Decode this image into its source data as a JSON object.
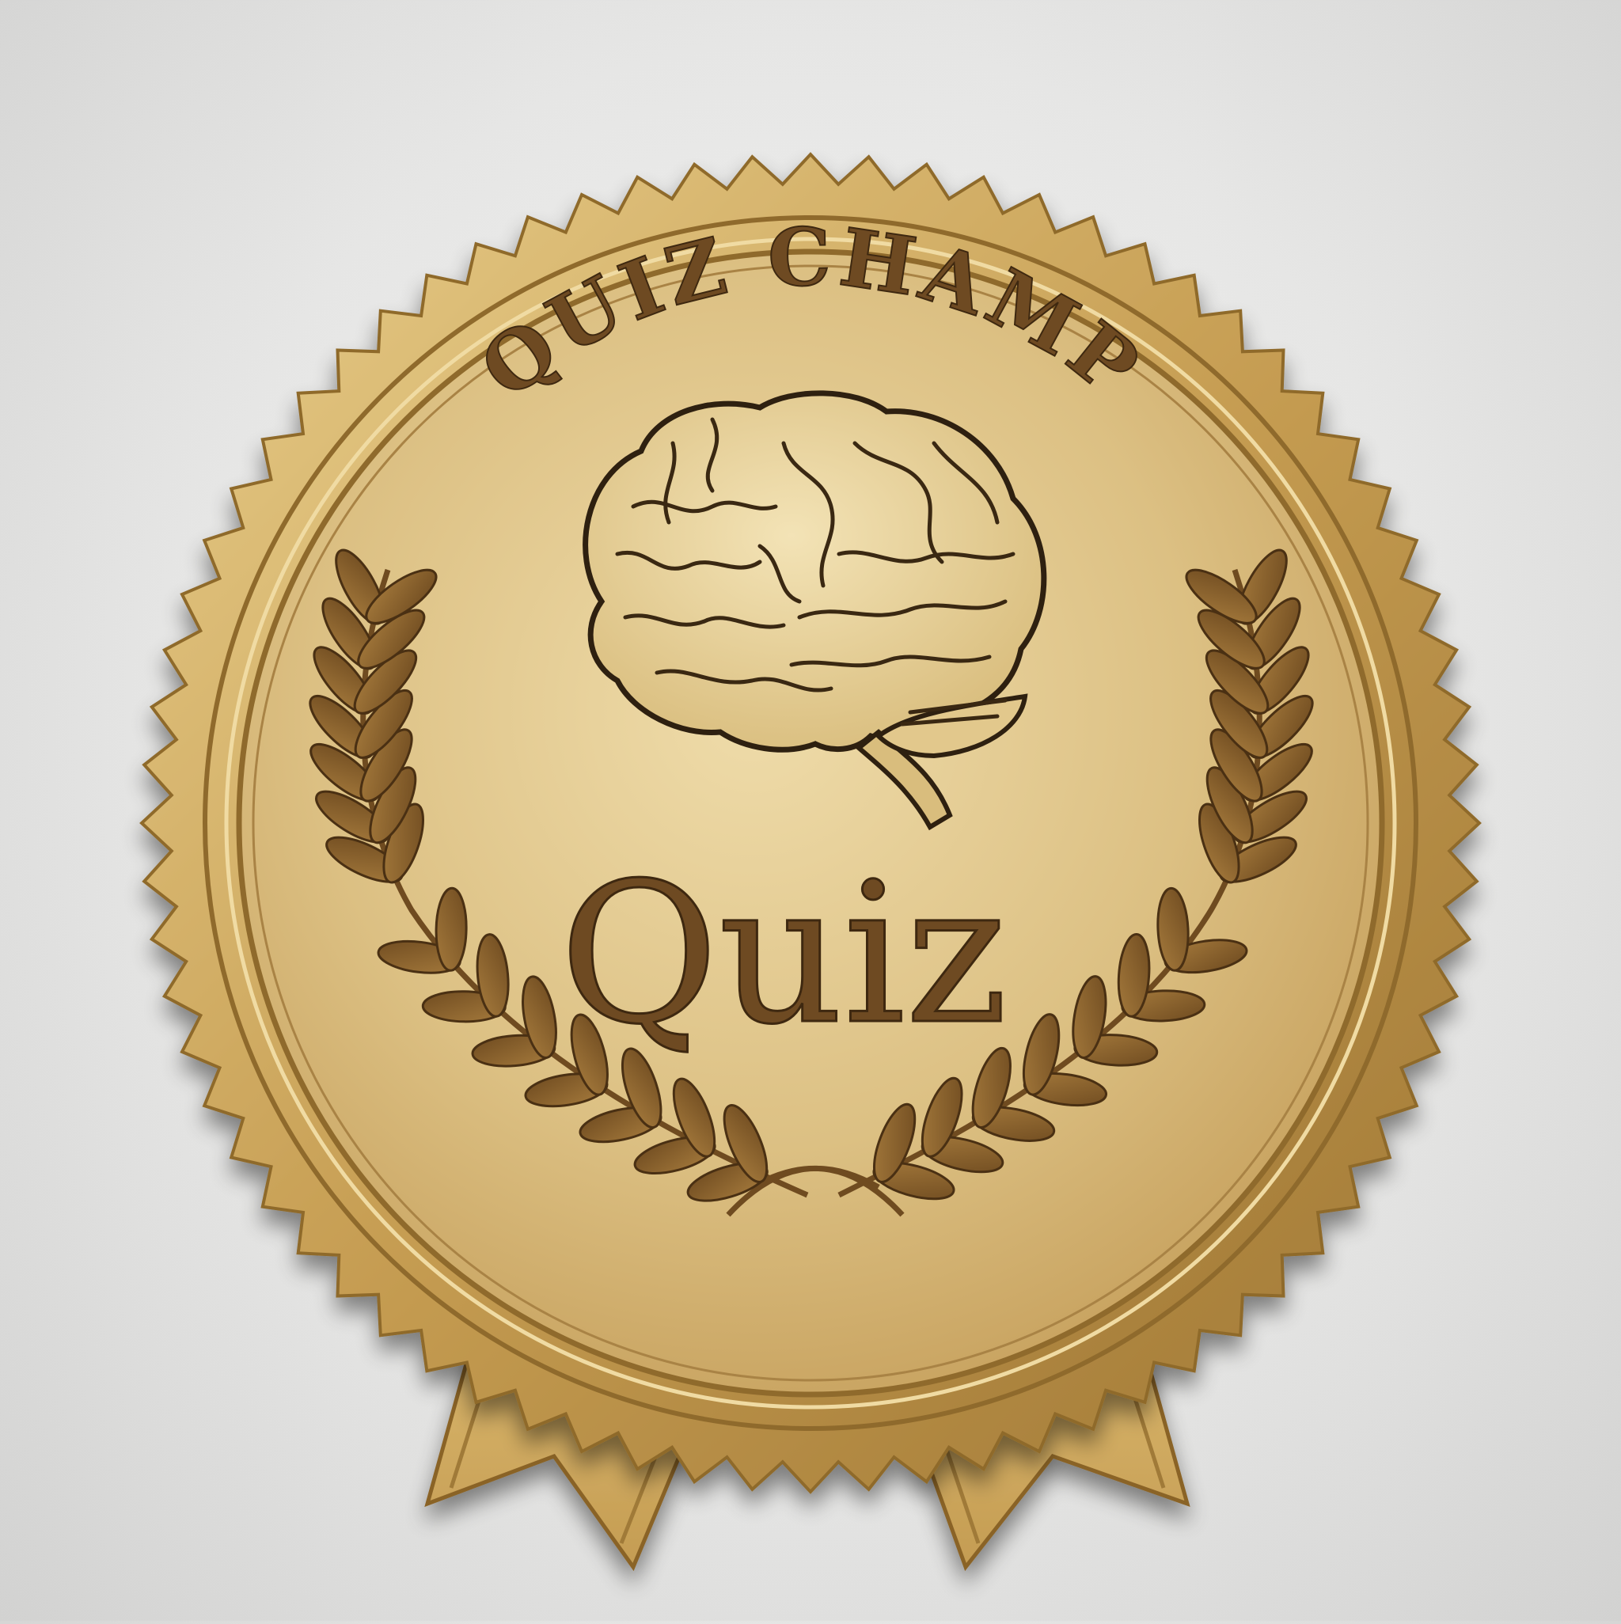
{
  "badge": {
    "arc_title": "QUIZ CHAMP",
    "center_word": "Quiz",
    "emblem_icon": "brain-icon",
    "wreath_icon": "laurel-wreath-icon",
    "ribbon_icon": "ribbon-tails-icon"
  },
  "colors": {
    "background": "#e6e6e5",
    "gold_light": "#eedba6",
    "gold": "#c9a25a",
    "gold_dark": "#8f6a2c",
    "ink": "#6e4a22",
    "ink_dark": "#3e2810"
  }
}
